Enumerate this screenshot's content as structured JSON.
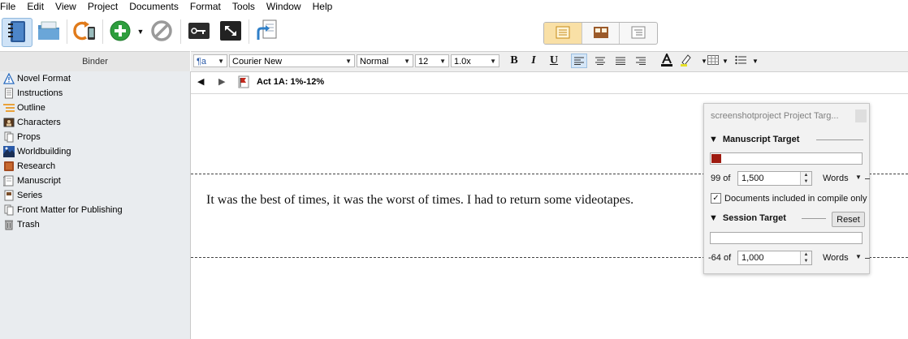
{
  "menubar": {
    "items": [
      "File",
      "Edit",
      "View",
      "Project",
      "Documents",
      "Format",
      "Tools",
      "Window",
      "Help"
    ]
  },
  "toolbar": {
    "buttons": [
      "binder-icon",
      "collections-icon",
      "sync-icon",
      "add-icon",
      "add-menu-icon",
      "delete-icon",
      "keywords-icon",
      "composition-mode-icon",
      "compile-icon"
    ],
    "view_modes": [
      "document-view-icon",
      "corkboard-view-icon",
      "outline-view-icon"
    ]
  },
  "binder": {
    "title": "Binder",
    "items": [
      {
        "label": "Novel Format",
        "icon": "warning-icon"
      },
      {
        "label": "Instructions",
        "icon": "document-icon"
      },
      {
        "label": "Outline",
        "icon": "outline-icon"
      },
      {
        "label": "Characters",
        "icon": "characters-icon"
      },
      {
        "label": "Props",
        "icon": "props-icon"
      },
      {
        "label": "Worldbuilding",
        "icon": "worldbuilding-icon"
      },
      {
        "label": "Research",
        "icon": "research-icon"
      },
      {
        "label": "Manuscript",
        "icon": "manuscript-icon"
      },
      {
        "label": "Series",
        "icon": "series-icon"
      },
      {
        "label": "Front Matter for Publishing",
        "icon": "front-matter-icon"
      },
      {
        "label": "Trash",
        "icon": "trash-icon"
      }
    ]
  },
  "formatbar": {
    "style": "¶a",
    "font": "Courier New",
    "typeface": "Normal",
    "size": "12",
    "line_spacing": "1.0x",
    "bold": "B",
    "italic": "I",
    "underline": "U"
  },
  "header": {
    "title": "Act 1A: 1%-12%"
  },
  "editor": {
    "text": "It was the best of times, it was the worst of times. I had to return some videotapes."
  },
  "target_panel": {
    "title": "screenshotproject Project Targ...",
    "manuscript": {
      "heading": "Manuscript Target",
      "count": "99 of",
      "target": "1,500",
      "unit": "Words",
      "progress": 0.066,
      "progress_color": "#9e1b10"
    },
    "compile_only_label": "Documents included in compile only",
    "compile_only_checked": true,
    "session": {
      "heading": "Session Target",
      "reset_label": "Reset",
      "count": "-64 of",
      "target": "1,000",
      "unit": "Words",
      "progress": 0
    }
  },
  "colors": {
    "active_view": "#f9e0a6",
    "binder_bg": "#e9ecef",
    "accent": "#3a7bd5"
  }
}
